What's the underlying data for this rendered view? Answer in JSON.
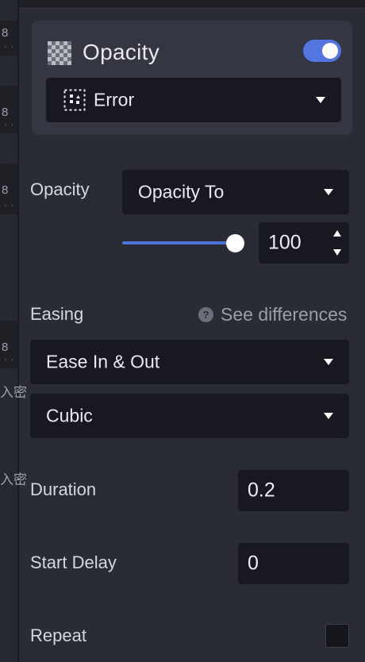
{
  "left_strip": {
    "tiles": [
      {
        "num": "8"
      },
      {
        "num": "8"
      },
      {
        "num": "8"
      },
      {
        "num": "8"
      }
    ],
    "glyphs": [
      "入密",
      "入密"
    ]
  },
  "card": {
    "title": "Opacity",
    "toggle_on": true,
    "preset_label": "Error"
  },
  "opacity": {
    "label": "Opacity",
    "mode": "Opacity To",
    "value": "100",
    "slider_percent": 100
  },
  "easing": {
    "label": "Easing",
    "help_glyph": "?",
    "see_differences": "See differences",
    "type": "Ease In & Out",
    "curve": "Cubic"
  },
  "duration": {
    "label": "Duration",
    "value": "0.2"
  },
  "start_delay": {
    "label": "Start Delay",
    "value": "0"
  },
  "repeat": {
    "label": "Repeat",
    "checked": false
  },
  "colors": {
    "accent": "#5375e0",
    "panel": "#2a2c35",
    "field": "#181920"
  }
}
